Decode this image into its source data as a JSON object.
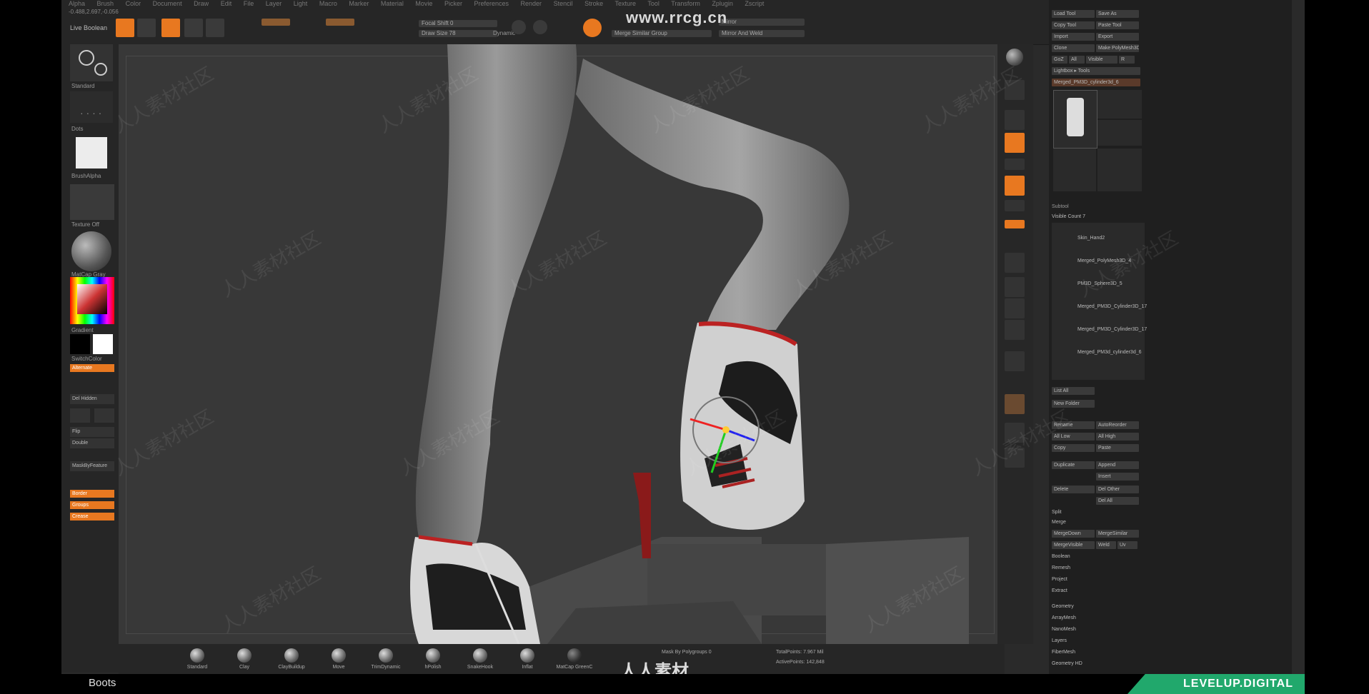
{
  "watermark_top": "www.rrcg.cn",
  "watermark_bottom": "人人素材",
  "watermark_diag": "人人素材社区",
  "topbar": {
    "menu": [
      "Alpha",
      "Brush",
      "Color",
      "Document",
      "Draw",
      "Edit",
      "File",
      "Layer",
      "Light",
      "Macro",
      "Marker",
      "Material",
      "Movie",
      "Picker",
      "Preferences",
      "Render",
      "Stencil",
      "Stroke",
      "Texture",
      "Tool",
      "Transform",
      "Zplugin",
      "Zscript"
    ],
    "coords": "-0.488,2.697,-0.056",
    "live_boolean": "Live Boolean",
    "focal_shift": "Focal Shift 0",
    "draw_size": "Draw Size 78",
    "dynamic": "Dynamic",
    "mirror": "Mirror",
    "merge_similar": "Merge Similar Group",
    "mirror_weld": "Mirror And Weld"
  },
  "left_panel": {
    "brush_label": "Standard",
    "stroke_label": "Dots",
    "alpha_label": "BrushAlpha",
    "texture_label": "Texture Off",
    "material_label": "MatCap Gray",
    "gradient_label": "Gradient",
    "switch_color": "SwitchColor",
    "alternate": "Alternate",
    "del_hidden": "Del Hidden",
    "flip": "Flip",
    "double": "Double",
    "mask_by_feature": "MaskByFeature",
    "border": "Border",
    "groups": "Groups",
    "crease": "Crease"
  },
  "right_panel": {
    "load_tool": "Load Tool",
    "save_as": "Save As",
    "copy_tool": "Copy Tool",
    "paste_tool": "Paste Tool",
    "import": "Import",
    "export": "Export",
    "clone": "Clone",
    "make_polymesh": "Make PolyMesh3D",
    "goz": "GoZ",
    "all": "All",
    "visible": "Visible",
    "r": "R",
    "lightbox_tools": "Lightbox ▸ Tools",
    "current_tool": "Merged_PM3D_cylinder3d_6",
    "subtool": "Subtool",
    "visible_count": "Visible Count 7",
    "subtools": [
      "Skin_Hand2",
      "Merged_PolyMesh3D_4",
      "PM3D_Sphere3D_5",
      "Merged_PM3D_Cylinder3D_17",
      "Merged_PM3D_Cylinder3D_17",
      "Merged_PM3d_cylinder3d_6"
    ],
    "list_all": "List All",
    "new_folder": "New Folder",
    "rename": "Rename",
    "autoreorder": "AutoReorder",
    "all_low": "All Low",
    "all_high": "All High",
    "copy": "Copy",
    "paste": "Paste",
    "duplicate": "Duplicate",
    "append": "Append",
    "insert": "Insert",
    "delete": "Delete",
    "del_other": "Del Other",
    "del_all": "Del All",
    "split": "Split",
    "merge": "Merge",
    "merge_down": "MergeDown",
    "merge_similar": "MergeSimilar",
    "merge_visible": "MergeVisible",
    "weld": "Weld",
    "uv": "Uv",
    "boolean": "Boolean",
    "remesh": "Remesh",
    "project": "Project",
    "extract": "Extract",
    "sections": [
      "Geometry",
      "ArrayMesh",
      "NanoMesh",
      "Layers",
      "FiberMesh",
      "Geometry HD"
    ]
  },
  "bottom_bar": {
    "brushes": [
      "Standard",
      "Clay",
      "ClayBuildup",
      "Move",
      "TrimDynamic",
      "hPolish",
      "SnakeHook",
      "Inflat",
      "MatCap GreenC"
    ],
    "mask_label": "Mask By Polygroups 0",
    "total_points": "TotalPoints: 7.967 Mil",
    "active_points": "ActivePoints: 142,848"
  },
  "caption": "Boots",
  "logo": "LEVELUP.DIGITAL",
  "colors": {
    "accent": "#e87820",
    "logo_green": "#21a86c",
    "bg": "#2a2a2a"
  }
}
